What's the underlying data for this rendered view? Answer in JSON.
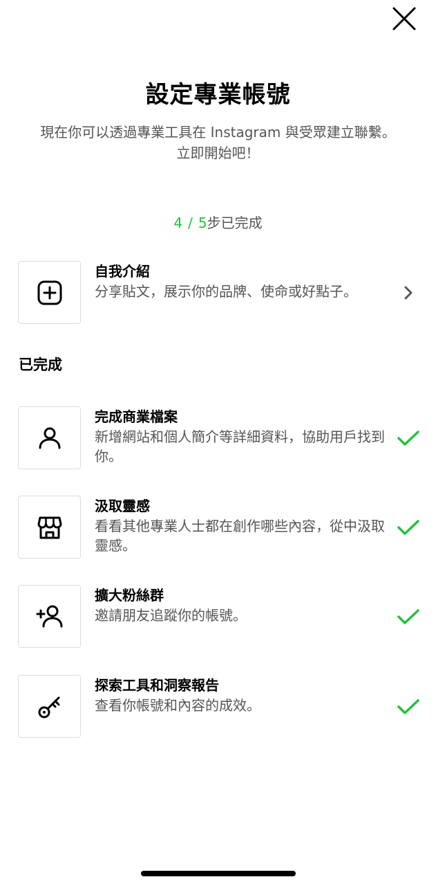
{
  "header": {
    "title": "設定專業帳號",
    "subtitle": "現在你可以透過專業工具在 Instagram 與受眾建立聯繫。立即開始吧！"
  },
  "progress": {
    "completed": "4",
    "separator": "/",
    "total": "5",
    "suffix": "步已完成"
  },
  "pending": [
    {
      "title": "自我介紹",
      "description": "分享貼文，展示你的品牌、使命或好點子。",
      "icon": "plus-square-icon"
    }
  ],
  "completed_section": {
    "label": "已完成",
    "items": [
      {
        "title": "完成商業檔案",
        "description": "新增網站和個人簡介等詳細資料，協助用戶找到你。",
        "icon": "person-icon"
      },
      {
        "title": "汲取靈感",
        "description": "看看其他專業人士都在創作哪些內容，從中汲取靈感。",
        "icon": "shop-icon"
      },
      {
        "title": "擴大粉絲群",
        "description": "邀請朋友追蹤你的帳號。",
        "icon": "add-person-icon"
      },
      {
        "title": "探索工具和洞察報告",
        "description": "查看你帳號和內容的成效。",
        "icon": "key-icon"
      }
    ]
  },
  "colors": {
    "accent_green": "#22c33a",
    "text_secondary": "#555555",
    "border": "#dcdcdc"
  }
}
